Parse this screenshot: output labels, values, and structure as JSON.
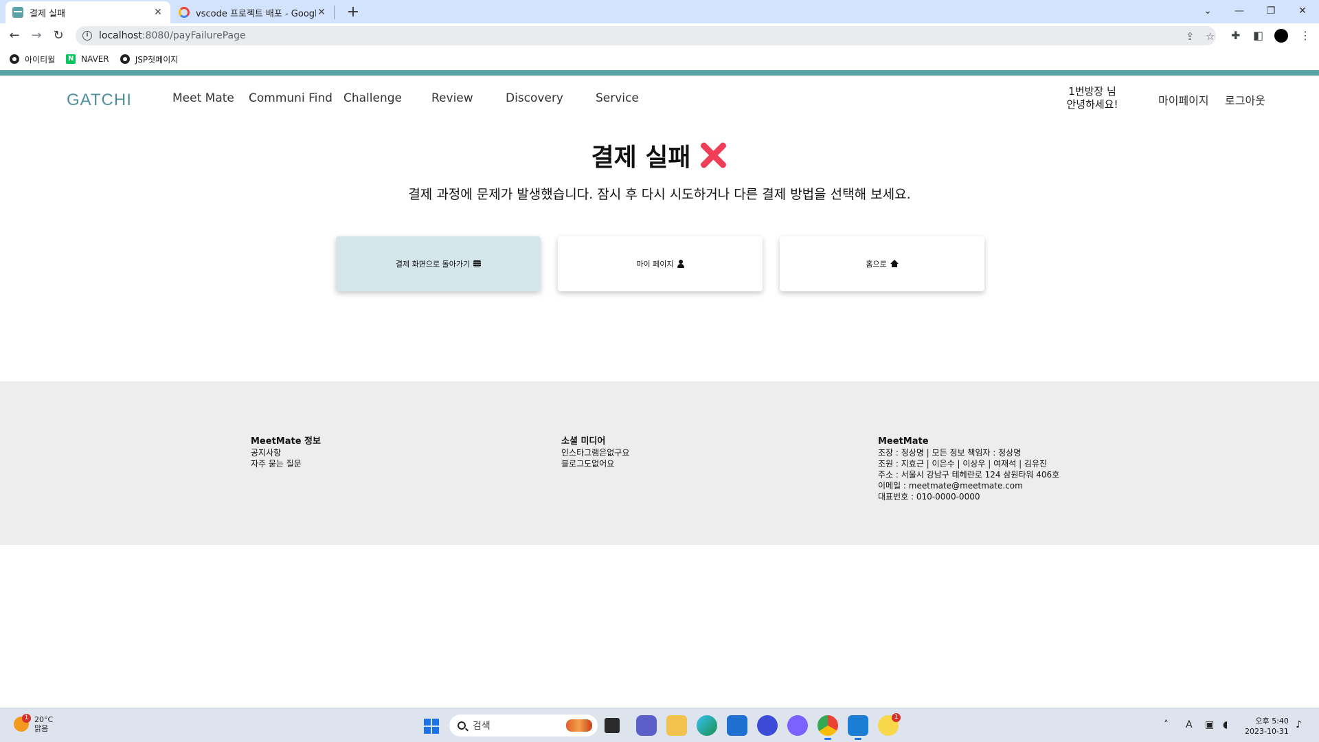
{
  "browser": {
    "tabs": [
      {
        "title": "결제 실패",
        "active": true
      },
      {
        "title": "vscode 프로젝트 배포 - Google",
        "active": false
      }
    ],
    "url_host": "localhost",
    "url_path": ":8080/payFailurePage",
    "bookmarks": [
      "아이티윌",
      "NAVER",
      "JSP첫페이지"
    ]
  },
  "site": {
    "brand": "GATCHI",
    "nav": [
      "Meet Mate",
      "Communi Find",
      "Challenge",
      "Review",
      "Discovery",
      "Service"
    ],
    "greeting_line1": "1번방장 님",
    "greeting_line2": "안녕하세요!",
    "mypage": "마이페이지",
    "logout": "로그아웃",
    "accent_color": "#5ba3a7"
  },
  "main": {
    "title": "결제 실패",
    "message": "결제 과정에 문제가 발생했습니다. 잠시 후 다시 시도하거나 다른 결제 방법을 선택해 보세요.",
    "buttons": [
      {
        "label": "결제 화면으로 돌아가기",
        "icon": "coins-icon"
      },
      {
        "label": "마이 페이지",
        "icon": "user-icon"
      },
      {
        "label": "홈으로",
        "icon": "home-icon"
      }
    ]
  },
  "footer": {
    "col1": {
      "heading": "MeetMate 정보",
      "lines": [
        "공지사항",
        "자주 묻는 질문"
      ]
    },
    "col2": {
      "heading": "소셜 미디어",
      "lines": [
        "인스타그램은없구요",
        "블로그도없어요"
      ]
    },
    "col3": {
      "heading": "MeetMate",
      "lines": [
        "조장 : 정상명 | 모든 정보 책임자 : 정상명",
        "조원 : 지효근 | 이은수 | 이상우 | 여재석 | 김유진",
        "주소 : 서울시 강남구 테헤란로 124 삼원타워 406호",
        "이메일 : meetmate@meetmate.com",
        "대표번호 : 010-0000-0000"
      ]
    }
  },
  "taskbar": {
    "weather_temp": "20°C",
    "weather_desc": "맑음",
    "weather_badge": "1",
    "search_placeholder": "검색",
    "time": "오후 5:40",
    "date": "2023-10-31",
    "ime": "A",
    "notif_badge": "1"
  }
}
